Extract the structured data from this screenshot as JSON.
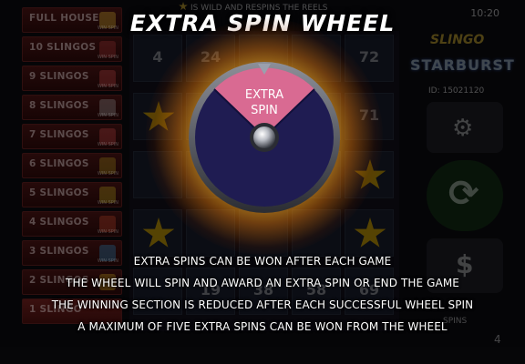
{
  "overlay": {
    "title": "EXTRA SPIN WHEEL",
    "wheel_segment_label_1": "EXTRA",
    "wheel_segment_label_2": "SPIN",
    "instructions": [
      "EXTRA SPINS CAN BE WON AFTER EACH GAME",
      "THE WHEEL WILL SPIN AND AWARD AN EXTRA SPIN OR END THE GAME",
      "THE WINNING SECTION IS REDUCED AFTER EACH SUCCESSFUL WHEEL SPIN",
      "A MAXIMUM OF FIVE EXTRA SPINS CAN BE WON FROM THE WHEEL"
    ]
  },
  "banner": {
    "text": "IS WILD AND RESPINS THE REELS"
  },
  "paytable": [
    {
      "label": "FULL HOUSE",
      "icon": "starburst-icon",
      "prize": "WIN SPIN"
    },
    {
      "label": "10 SLINGOS",
      "icon": "bar-icon",
      "prize": "WIN SPIN"
    },
    {
      "label": "9 SLINGOS",
      "icon": "seven-icon",
      "prize": "WIN SPIN"
    },
    {
      "label": "8 SLINGOS",
      "icon": "bar-icon",
      "prize": "WIN SPIN"
    },
    {
      "label": "7 SLINGOS",
      "icon": "seven-icon",
      "prize": "WIN SPIN"
    },
    {
      "label": "6 SLINGOS",
      "icon": "gem-icon",
      "prize": "WIN SPIN"
    },
    {
      "label": "5 SLINGOS",
      "icon": "gem-icon",
      "prize": "WIN SPIN"
    },
    {
      "label": "4 SLINGOS",
      "icon": "gem-icon",
      "prize": "WIN SPIN"
    },
    {
      "label": "3 SLINGOS",
      "icon": "gem-icon",
      "prize": "WIN SPIN"
    },
    {
      "label": "2 SLINGOS",
      "icon": "arrow-up-icon",
      "prize": ""
    },
    {
      "label": "1 SLINGO",
      "icon": "",
      "prize": ""
    }
  ],
  "grid": {
    "top_numbers": [
      "4",
      "24",
      "",
      "",
      "72"
    ],
    "row2": [
      "",
      "",
      "",
      "",
      "71"
    ],
    "bottom_numbers": [
      "",
      "19",
      "38",
      "58",
      "69"
    ],
    "cells": [
      "num:4",
      "num:24",
      "",
      "",
      "num:72",
      "star",
      "",
      "",
      "",
      "num:71",
      "",
      "",
      "",
      "",
      "star",
      "star",
      "",
      "",
      "",
      "star",
      "",
      "num:19",
      "num:38",
      "num:58",
      "num:69"
    ]
  },
  "right_panel": {
    "clock": "10:20",
    "logo_top": "SLINGO",
    "logo_bottom": "STARBURST",
    "game_id": "ID: 15021120",
    "spins_label": "SPINS",
    "spins_value": "4"
  },
  "colors": {
    "wheel_win_segment": "#d95a8a",
    "wheel_body": "#1e1e5a",
    "glow": "#ffc33a"
  }
}
